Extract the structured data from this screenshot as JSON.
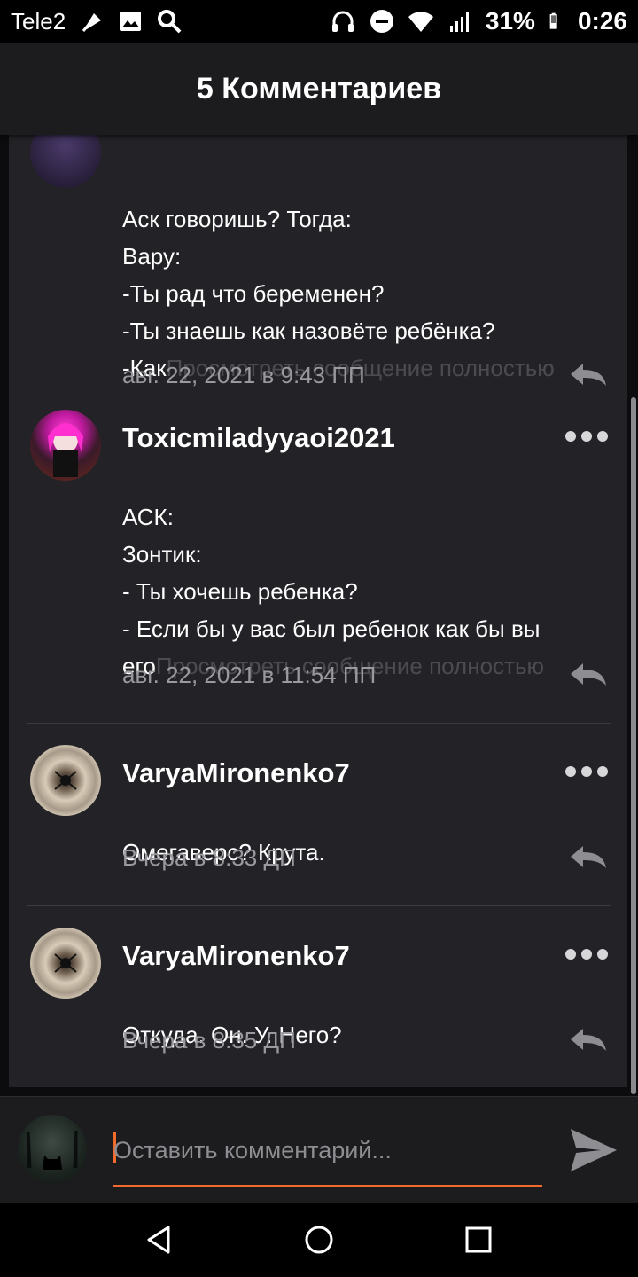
{
  "status_bar": {
    "carrier": "Tele2",
    "battery": "31%",
    "time": "0:26"
  },
  "header": {
    "title": "5 Комментариев"
  },
  "comments": [
    {
      "username": "",
      "body": "Аск говоришь? Тогда:\nВару:\n-Ты рад что беременен?\n-Ты знаешь как назовёте ребёнка?\n-Как",
      "more_link": "Просмотреть сообщение полностью",
      "date": "авг. 22, 2021 в 9:43 ПП"
    },
    {
      "username": "Toxicmiladyyaoi2021",
      "body": "АСК:\nЗонтик:\n-  Ты хочешь ребенка?\n-  Если бы у вас был ребенок как бы вы\nего",
      "more_link": "Просмотреть сообщение полностью",
      "date": "авг. 22, 2021 в 11:54 ПП"
    },
    {
      "username": "VaryaMironenko7",
      "body": "Омегаверс? Крута.",
      "date": "Вчера в 8:33 ДП"
    },
    {
      "username": "VaryaMironenko7",
      "body": "Откуда. Он. У. Него?",
      "date": "Вчера в 8:35 ДП"
    }
  ],
  "compose": {
    "placeholder": "Оставить комментарий..."
  },
  "colors": {
    "accent": "#f06a2c",
    "background": "#232226",
    "header": "#1c1b1e"
  }
}
